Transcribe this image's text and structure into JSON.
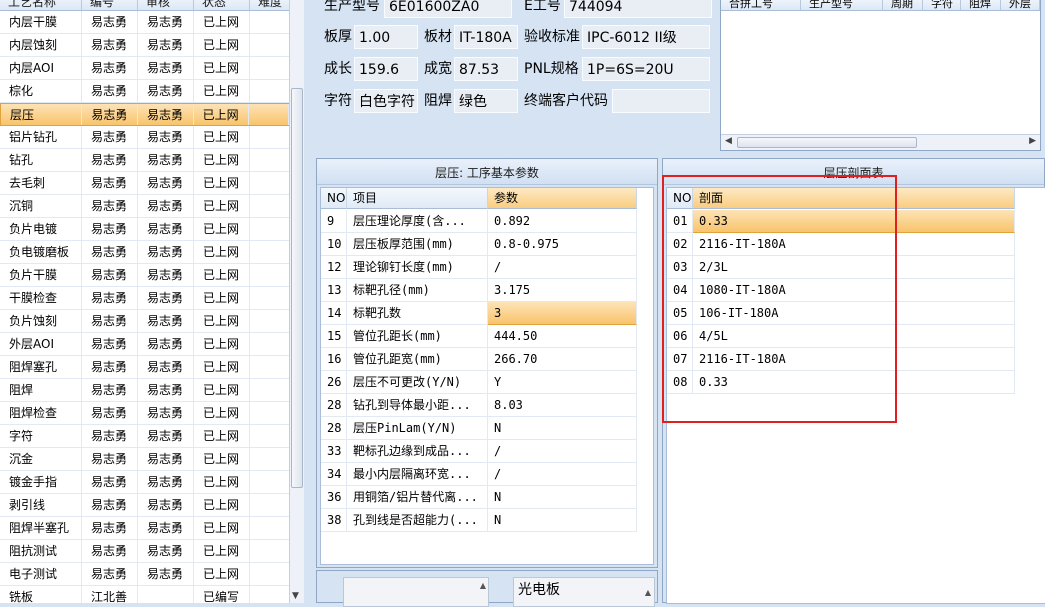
{
  "left_grid": {
    "columns": [
      "工艺名称",
      "编号",
      "审核",
      "状态",
      "难度"
    ],
    "rows": [
      [
        "内层干膜",
        "易志勇",
        "易志勇",
        "已上网",
        ""
      ],
      [
        "内层蚀刻",
        "易志勇",
        "易志勇",
        "已上网",
        ""
      ],
      [
        "内层AOI",
        "易志勇",
        "易志勇",
        "已上网",
        ""
      ],
      [
        "棕化",
        "易志勇",
        "易志勇",
        "已上网",
        ""
      ],
      [
        "层压",
        "易志勇",
        "易志勇",
        "已上网",
        ""
      ],
      [
        "铝片钻孔",
        "易志勇",
        "易志勇",
        "已上网",
        ""
      ],
      [
        "钻孔",
        "易志勇",
        "易志勇",
        "已上网",
        ""
      ],
      [
        "去毛刺",
        "易志勇",
        "易志勇",
        "已上网",
        ""
      ],
      [
        "沉铜",
        "易志勇",
        "易志勇",
        "已上网",
        ""
      ],
      [
        "负片电镀",
        "易志勇",
        "易志勇",
        "已上网",
        ""
      ],
      [
        "负电镀磨板",
        "易志勇",
        "易志勇",
        "已上网",
        ""
      ],
      [
        "负片干膜",
        "易志勇",
        "易志勇",
        "已上网",
        ""
      ],
      [
        "干膜检查",
        "易志勇",
        "易志勇",
        "已上网",
        ""
      ],
      [
        "负片蚀刻",
        "易志勇",
        "易志勇",
        "已上网",
        ""
      ],
      [
        "外层AOI",
        "易志勇",
        "易志勇",
        "已上网",
        ""
      ],
      [
        "阻焊塞孔",
        "易志勇",
        "易志勇",
        "已上网",
        ""
      ],
      [
        "阻焊",
        "易志勇",
        "易志勇",
        "已上网",
        ""
      ],
      [
        "阻焊检查",
        "易志勇",
        "易志勇",
        "已上网",
        ""
      ],
      [
        "字符",
        "易志勇",
        "易志勇",
        "已上网",
        ""
      ],
      [
        "沉金",
        "易志勇",
        "易志勇",
        "已上网",
        ""
      ],
      [
        "镀金手指",
        "易志勇",
        "易志勇",
        "已上网",
        ""
      ],
      [
        "剥引线",
        "易志勇",
        "易志勇",
        "已上网",
        ""
      ],
      [
        "阻焊半塞孔",
        "易志勇",
        "易志勇",
        "已上网",
        ""
      ],
      [
        "阻抗测试",
        "易志勇",
        "易志勇",
        "已上网",
        ""
      ],
      [
        "电子测试",
        "易志勇",
        "易志勇",
        "已上网",
        ""
      ],
      [
        "铣板",
        "江北善",
        "",
        "已编写",
        ""
      ]
    ],
    "selected_index": 4
  },
  "info": {
    "model_label": "生产型号",
    "model_value": "6E01600ZA0",
    "e_no_label": "E工号",
    "e_no_value": "744094",
    "thickness_label": "板厚",
    "thickness_value": "1.00",
    "material_label": "板材",
    "material_value": "IT-180A",
    "standard_label": "验收标准",
    "standard_value": "IPC-6012 II级",
    "length_label": "成长",
    "length_value": "159.6",
    "width_label": "成宽",
    "width_value": "87.53",
    "pnl_label": "PNL规格",
    "pnl_value": "1P=6S=20U",
    "char_label": "字符",
    "char_value": "白色字符",
    "mask_label": "阻焊",
    "mask_value": "绿色",
    "customer_label": "终端客户代码",
    "customer_value": ""
  },
  "top_right_grid": {
    "columns": [
      "合拼工号",
      "生产型号",
      "周期",
      "字符",
      "阻焊",
      "外层"
    ]
  },
  "params_panel": {
    "title": "层压: 工序基本参数",
    "columns": [
      "NO",
      "项目",
      "参数"
    ],
    "rows": [
      [
        "9",
        "层压理论厚度(含...",
        "0.892"
      ],
      [
        "10",
        "层压板厚范围(mm)",
        "0.8-0.975"
      ],
      [
        "12",
        "理论铆钉长度(mm)",
        "/"
      ],
      [
        "13",
        "标靶孔径(mm)",
        "3.175"
      ],
      [
        "14",
        "标靶孔数",
        "3"
      ],
      [
        "15",
        "管位孔距长(mm)",
        "444.50"
      ],
      [
        "16",
        "管位孔距宽(mm)",
        "266.70"
      ],
      [
        "26",
        "层压不可更改(Y/N)",
        "Y"
      ],
      [
        "28",
        "钻孔到导体最小距...",
        "8.03"
      ],
      [
        "28",
        "层压PinLam(Y/N)",
        "N"
      ],
      [
        "33",
        "靶标孔边缘到成品...",
        "/"
      ],
      [
        "34",
        "最小内层隔离环宽...",
        "/"
      ],
      [
        "36",
        "用铜箔/铝片替代离...",
        "N"
      ],
      [
        "38",
        "孔到线是否超能力(...",
        "N"
      ]
    ],
    "selected_index": 4
  },
  "section_panel": {
    "title": "层压剖面表",
    "columns": [
      "NO",
      "剖面"
    ],
    "rows": [
      [
        "01",
        "0.33"
      ],
      [
        "02",
        "2116-IT-180A"
      ],
      [
        "03",
        "2/3L"
      ],
      [
        "04",
        "1080-IT-180A"
      ],
      [
        "05",
        "106-IT-180A"
      ],
      [
        "06",
        "4/5L"
      ],
      [
        "07",
        "2116-IT-180A"
      ],
      [
        "08",
        "0.33"
      ]
    ],
    "selected_index": 0
  },
  "bottom": {
    "option_value": "光电板"
  },
  "colors": {
    "background": "#d6e3f3",
    "selection": "#f8c46c",
    "highlight_box": "#e02020"
  }
}
